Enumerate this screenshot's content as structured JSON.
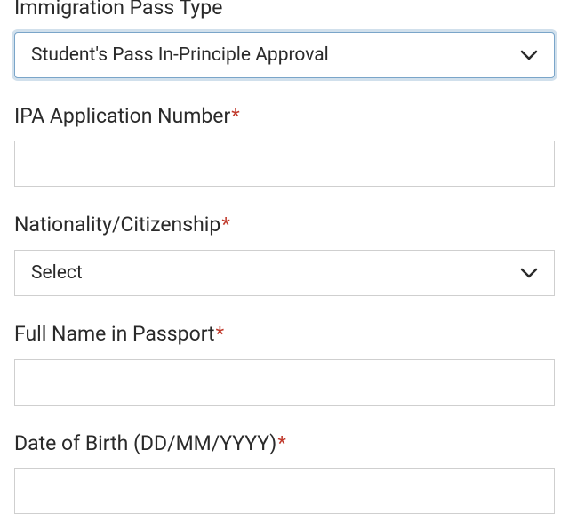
{
  "fields": {
    "pass_type": {
      "label": "Immigration Pass Type",
      "required": true,
      "value": "Student's Pass In-Principle Approval"
    },
    "ipa_number": {
      "label": "IPA Application Number",
      "required": true,
      "required_mark": "*",
      "value": ""
    },
    "nationality": {
      "label": "Nationality/Citizenship",
      "required": true,
      "required_mark": "*",
      "placeholder": "Select",
      "value": ""
    },
    "full_name": {
      "label": "Full Name in Passport",
      "required": true,
      "required_mark": "*",
      "value": ""
    },
    "dob": {
      "label": "Date of Birth (DD/MM/YYYY)",
      "required": true,
      "required_mark": "*",
      "value": ""
    }
  }
}
